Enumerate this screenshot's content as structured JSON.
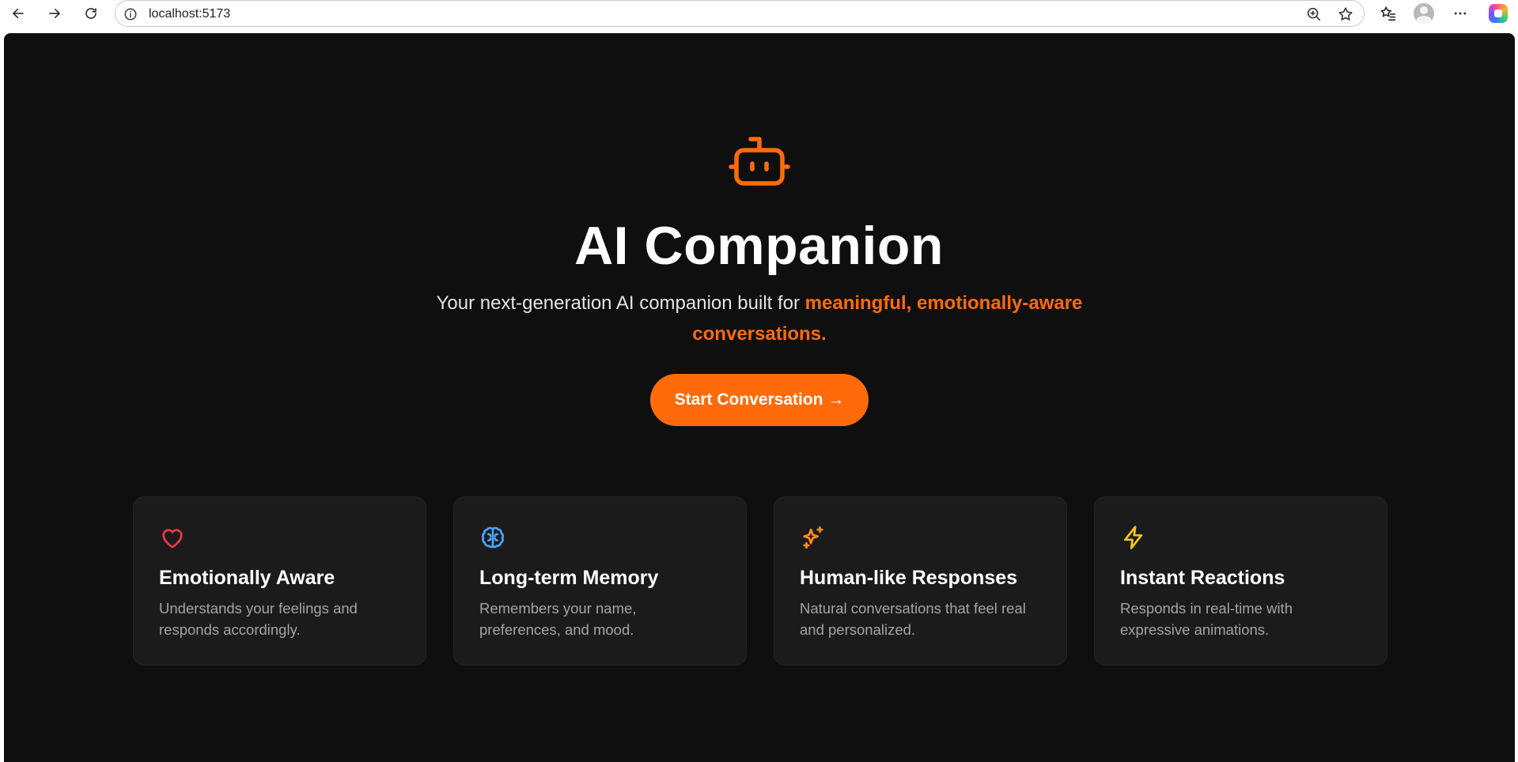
{
  "browser": {
    "url": "localhost:5173",
    "icons": [
      "back-arrow-icon",
      "forward-arrow-icon",
      "reload-icon",
      "info-icon",
      "zoom-icon",
      "star-icon",
      "favorites-icon",
      "profile-icon",
      "more-icon",
      "copilot-icon"
    ]
  },
  "hero": {
    "icon": "robot-icon",
    "title": "AI Companion",
    "subtitle_plain": "Your next-generation AI companion built for ",
    "subtitle_accent": "meaningful, emotionally-aware conversations.",
    "cta_label": "Start Conversation →"
  },
  "features": [
    {
      "icon": "heart-icon",
      "icon_color": "#e63946",
      "title": "Emotionally Aware",
      "description": "Understands your feelings and responds accordingly."
    },
    {
      "icon": "brain-icon",
      "icon_color": "#4aa3ff",
      "title": "Long-term Memory",
      "description": "Remembers your name, preferences, and mood."
    },
    {
      "icon": "sparkles-icon",
      "icon_color": "#ff8a1f",
      "title": "Human-like Responses",
      "description": "Natural conversations that feel real and personalized."
    },
    {
      "icon": "lightning-icon",
      "icon_color": "#f5c518",
      "title": "Instant Reactions",
      "description": "Responds in real-time with expressive animations."
    }
  ],
  "colors": {
    "accent": "#ff6b0a",
    "background": "#0f0f0f",
    "card_background": "#1b1b1b"
  }
}
